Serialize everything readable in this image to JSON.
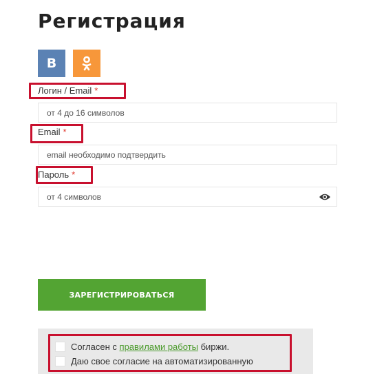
{
  "page": {
    "title": "Регистрация"
  },
  "social": {
    "vk_label": "B",
    "ok_icon": "odnoklassniki-icon",
    "vk_color": "#5b82b4",
    "ok_color": "#f7973a"
  },
  "form": {
    "login": {
      "label": "Логин / Email",
      "required_mark": "*",
      "placeholder": "от 4 до 16 символов",
      "value": ""
    },
    "email": {
      "label": "Email",
      "required_mark": "*",
      "placeholder": "email необходимо подтвердить",
      "value": ""
    },
    "password": {
      "label": "Пароль",
      "required_mark": "*",
      "placeholder": "от 4 символов",
      "value": "",
      "toggle_icon": "eye-icon"
    },
    "submit_label": "ЗАРЕГИСТРИРОВАТЬСЯ"
  },
  "agreements": {
    "rules_prefix": "Согласен с ",
    "rules_link": "правилами работы",
    "rules_suffix": " биржи.",
    "data_consent": "Даю свое согласие на автоматизированную"
  },
  "colors": {
    "accent_green": "#53a433",
    "highlight_red": "#c8102e",
    "required_red": "#e0362c"
  }
}
